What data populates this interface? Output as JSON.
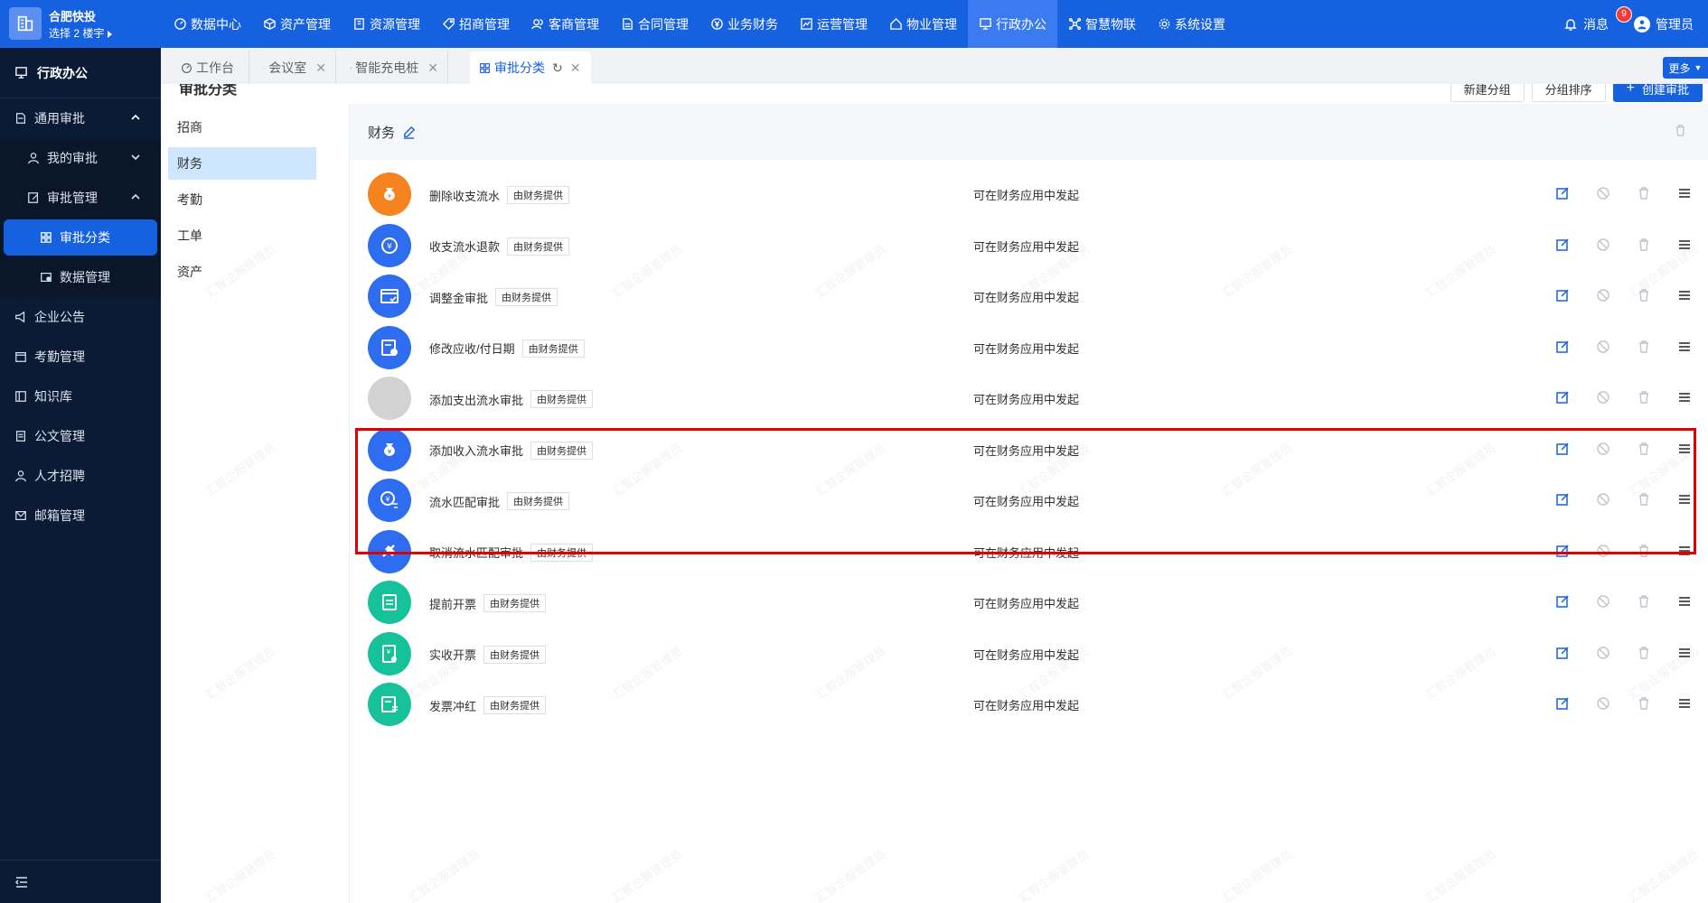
{
  "app": {
    "name": "合肥快投",
    "location": "选择 2 楼宇"
  },
  "nav": [
    {
      "label": "数据中心",
      "icon": "dashboard-icon"
    },
    {
      "label": "资产管理",
      "icon": "cube-icon"
    },
    {
      "label": "资源管理",
      "icon": "building-icon"
    },
    {
      "label": "招商管理",
      "icon": "tag-icon"
    },
    {
      "label": "客商管理",
      "icon": "users-icon"
    },
    {
      "label": "合同管理",
      "icon": "document-icon"
    },
    {
      "label": "业务财务",
      "icon": "yuan-icon"
    },
    {
      "label": "运营管理",
      "icon": "chart-icon"
    },
    {
      "label": "物业管理",
      "icon": "home-icon"
    },
    {
      "label": "行政办公",
      "icon": "monitor-icon"
    },
    {
      "label": "智慧物联",
      "icon": "iot-icon"
    },
    {
      "label": "系统设置",
      "icon": "gear-icon"
    }
  ],
  "top_right": {
    "messages_label": "消息",
    "messages_count": "9",
    "user_label": "管理员"
  },
  "sidebar": {
    "header": "行政办公",
    "items": [
      {
        "label": "通用审批"
      },
      {
        "label": "我的审批"
      },
      {
        "label": "审批管理"
      },
      {
        "label": "审批分类"
      },
      {
        "label": "数据管理"
      },
      {
        "label": "企业公告"
      },
      {
        "label": "考勤管理"
      },
      {
        "label": "知识库"
      },
      {
        "label": "公文管理"
      },
      {
        "label": "人才招聘"
      },
      {
        "label": "邮箱管理"
      }
    ]
  },
  "tabs": [
    {
      "label": "工作台"
    },
    {
      "label": "会议室"
    },
    {
      "label": "智能充电桩"
    },
    {
      "label": "审批分类"
    }
  ],
  "more_label": "更多",
  "page": {
    "title": "审批分类",
    "buttons": {
      "new_group": "新建分组",
      "sort_group": "分组排序",
      "create": "创建审批"
    },
    "categories": [
      "招商",
      "财务",
      "考勤",
      "工单",
      "资产"
    ],
    "group_name": "财务"
  },
  "rows": [
    {
      "name": "删除收支流水",
      "tag": "由财务提供",
      "desc": "可在财务应用中发起",
      "color": "#f5831f",
      "icon": "money-bag-icon"
    },
    {
      "name": "收支流水退款",
      "tag": "由财务提供",
      "desc": "可在财务应用中发起",
      "color": "#2f6df0",
      "icon": "refund-icon"
    },
    {
      "name": "调整金审批",
      "tag": "由财务提供",
      "desc": "可在财务应用中发起",
      "color": "#2f6df0",
      "icon": "bill-icon"
    },
    {
      "name": "修改应收/付日期",
      "tag": "由财务提供",
      "desc": "可在财务应用中发起",
      "color": "#2f6df0",
      "icon": "calendar-icon"
    },
    {
      "name": "添加支出流水审批",
      "tag": "由财务提供",
      "desc": "可在财务应用中发起",
      "color": "#d2d2d2",
      "icon": "blank-icon"
    },
    {
      "name": "添加收入流水审批",
      "tag": "由财务提供",
      "desc": "可在财务应用中发起",
      "color": "#2f6df0",
      "icon": "money-bag-icon"
    },
    {
      "name": "流水匹配审批",
      "tag": "由财务提供",
      "desc": "可在财务应用中发起",
      "color": "#2f6df0",
      "icon": "exchange-icon"
    },
    {
      "name": "取消流水匹配审批",
      "tag": "由财务提供",
      "desc": "可在财务应用中发起",
      "color": "#2f6df0",
      "icon": "unlink-icon"
    },
    {
      "name": "提前开票",
      "tag": "由财务提供",
      "desc": "可在财务应用中发起",
      "color": "#17c29a",
      "icon": "invoice-icon"
    },
    {
      "name": "实收开票",
      "tag": "由财务提供",
      "desc": "可在财务应用中发起",
      "color": "#17c29a",
      "icon": "receipt-icon"
    },
    {
      "name": "发票冲红",
      "tag": "由财务提供",
      "desc": "可在财务应用中发起",
      "color": "#17c29a",
      "icon": "invoice-reverse-icon"
    }
  ],
  "watermark": "汇智企服管理员"
}
